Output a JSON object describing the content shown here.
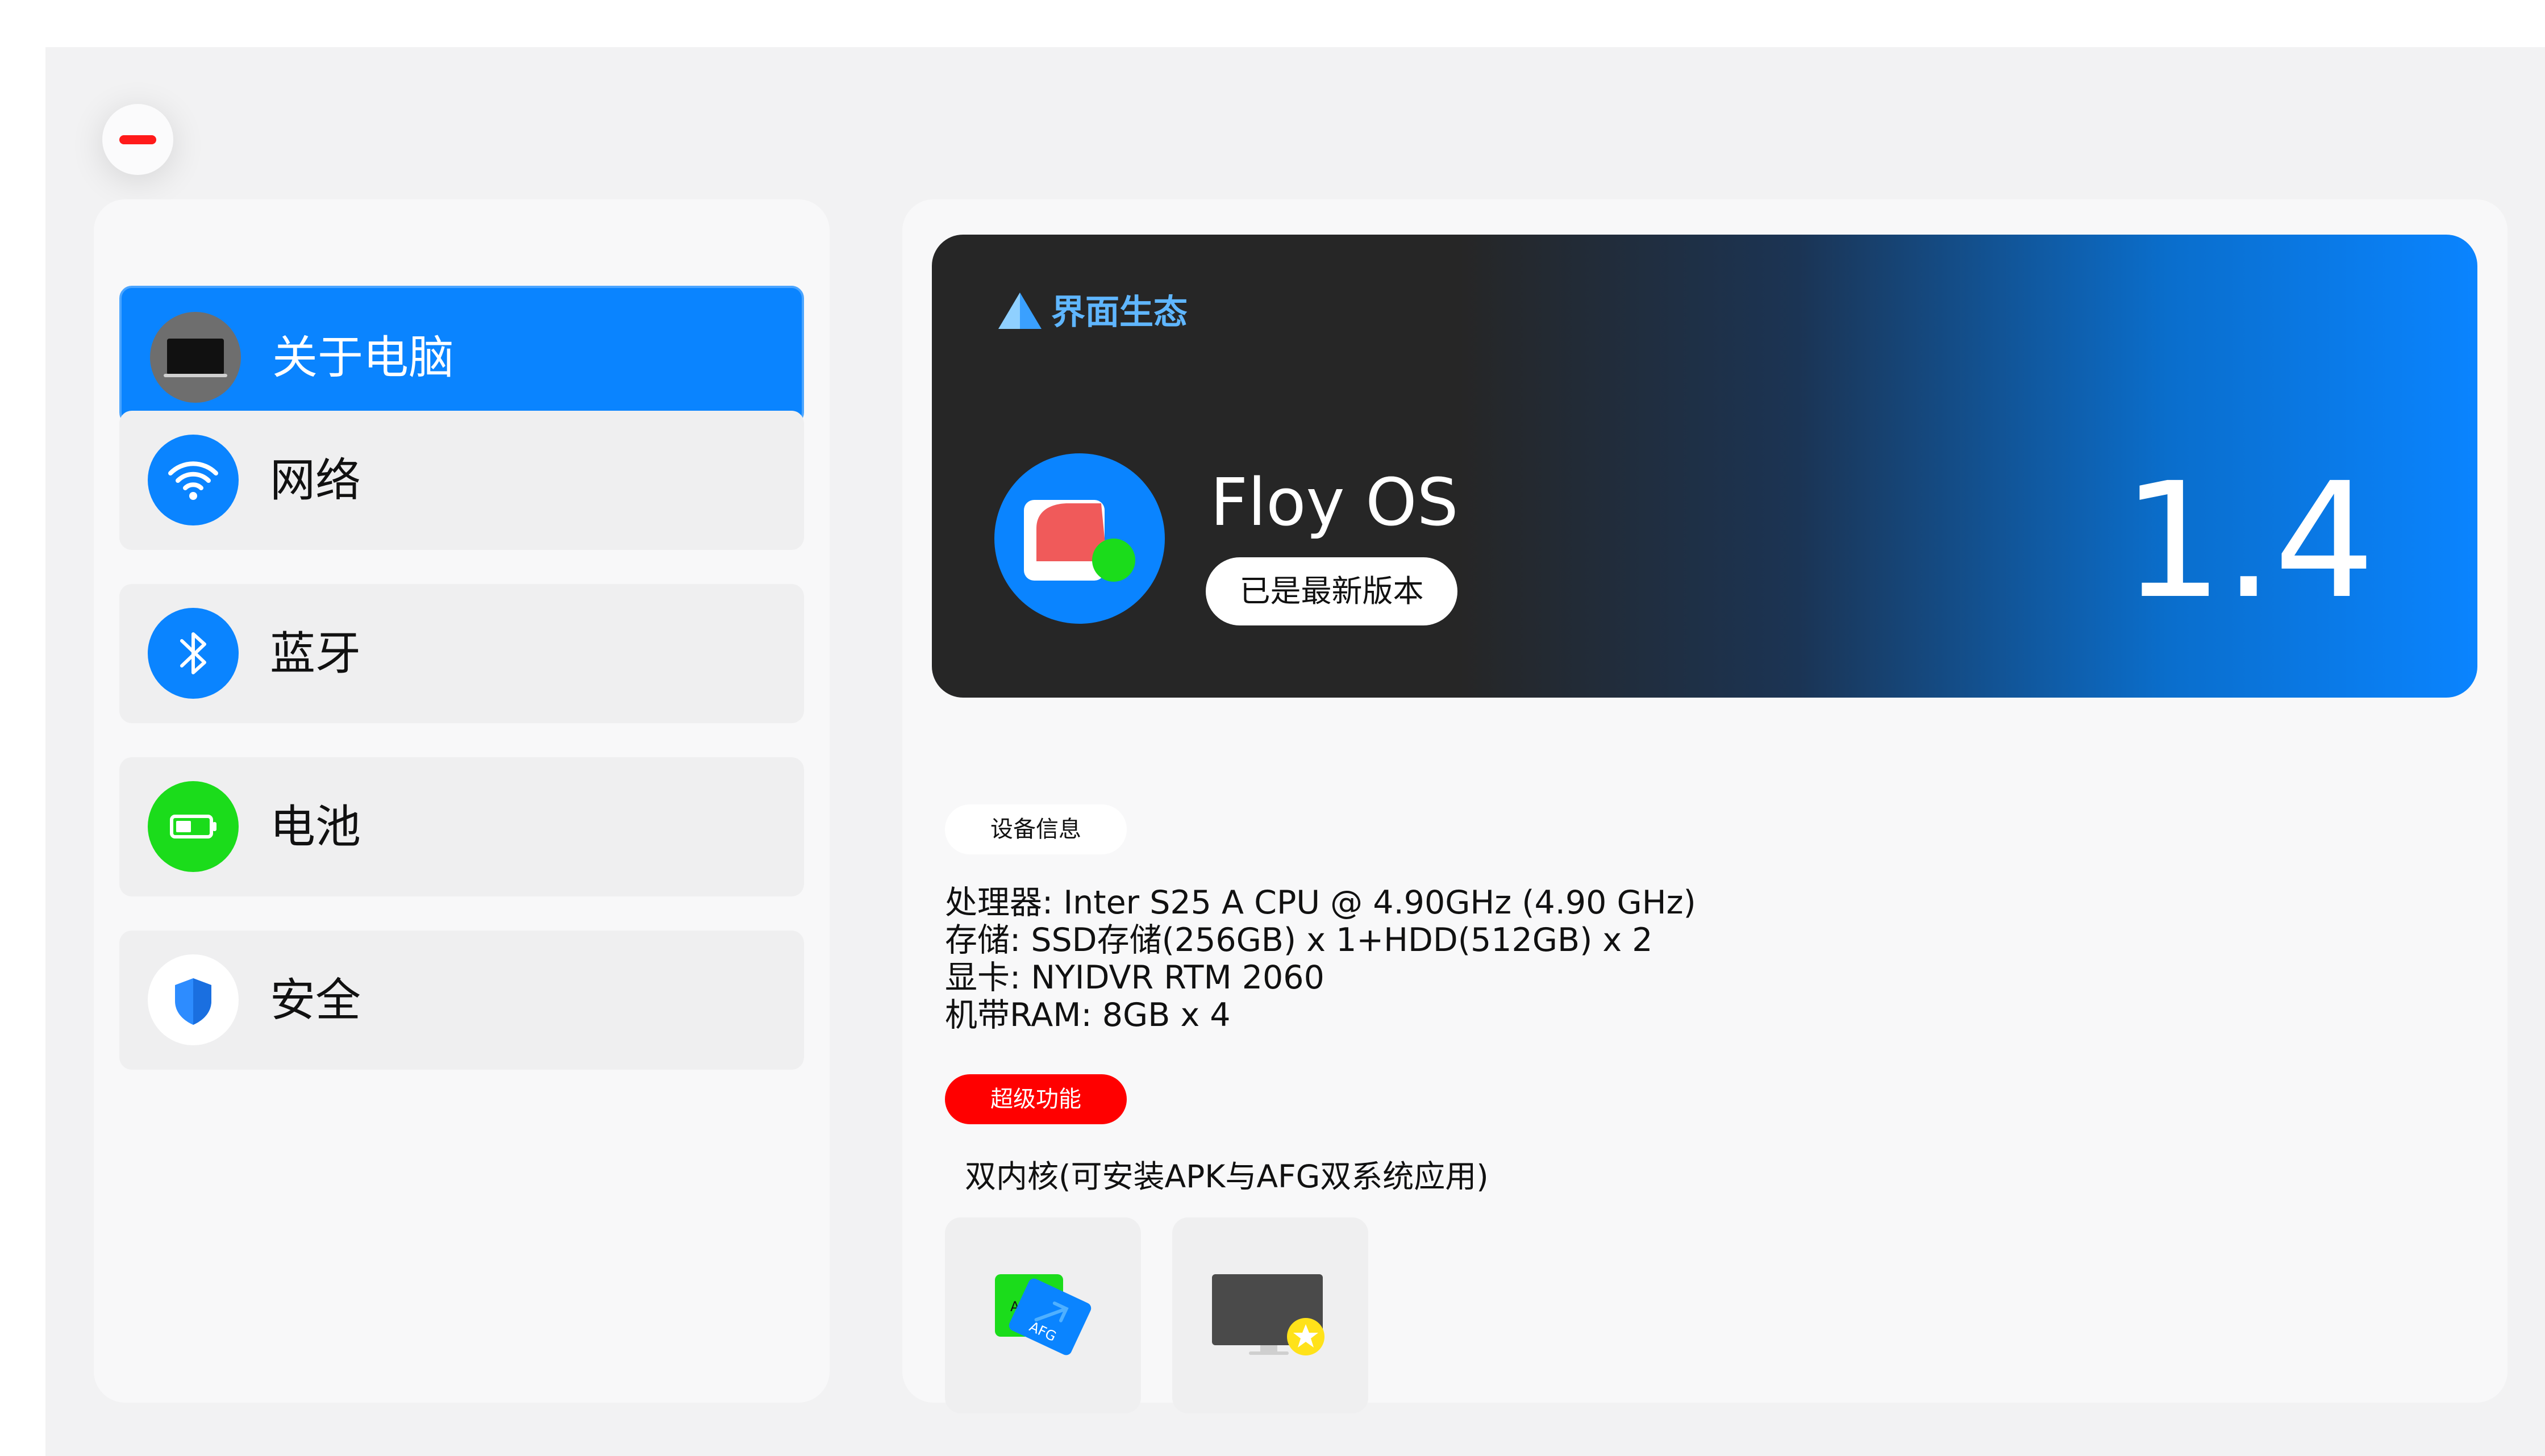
{
  "sidebar": {
    "items": [
      {
        "label": "关于电脑",
        "icon": "laptop-icon",
        "active": true
      },
      {
        "label": "网络",
        "icon": "wifi-icon",
        "active": false
      },
      {
        "label": "蓝牙",
        "icon": "bluetooth-icon",
        "active": false
      },
      {
        "label": "电池",
        "icon": "battery-icon",
        "active": false
      },
      {
        "label": "安全",
        "icon": "shield-icon",
        "active": false
      }
    ]
  },
  "banner": {
    "brand": "界面生态",
    "os_name": "Floy OS",
    "update_status": "已是最新版本",
    "version": "1.4"
  },
  "device_info": {
    "section_label": "设备信息",
    "lines": [
      "处理器: Inter S25 A CPU @ 4.90GHz (4.90 GHz)",
      "存储: SSD存储(256GB) x 1+HDD(512GB) x 2",
      "显卡: NYIDVR RTM 2060",
      "机带RAM: 8GB x 4"
    ]
  },
  "super_features": {
    "section_label": "超级功能",
    "description": "双内核(可安装APK与AFG双系统应用)",
    "cards": [
      {
        "icon": "apk-afg-dual-system-icon",
        "badge_text": "AFG",
        "behind_text": "AP"
      },
      {
        "icon": "featured-monitor-icon"
      }
    ]
  },
  "colors": {
    "accent": "#0a84ff",
    "close": "#ff1a1a",
    "battery": "#1bdc1b",
    "super_tag": "#ff0000"
  }
}
